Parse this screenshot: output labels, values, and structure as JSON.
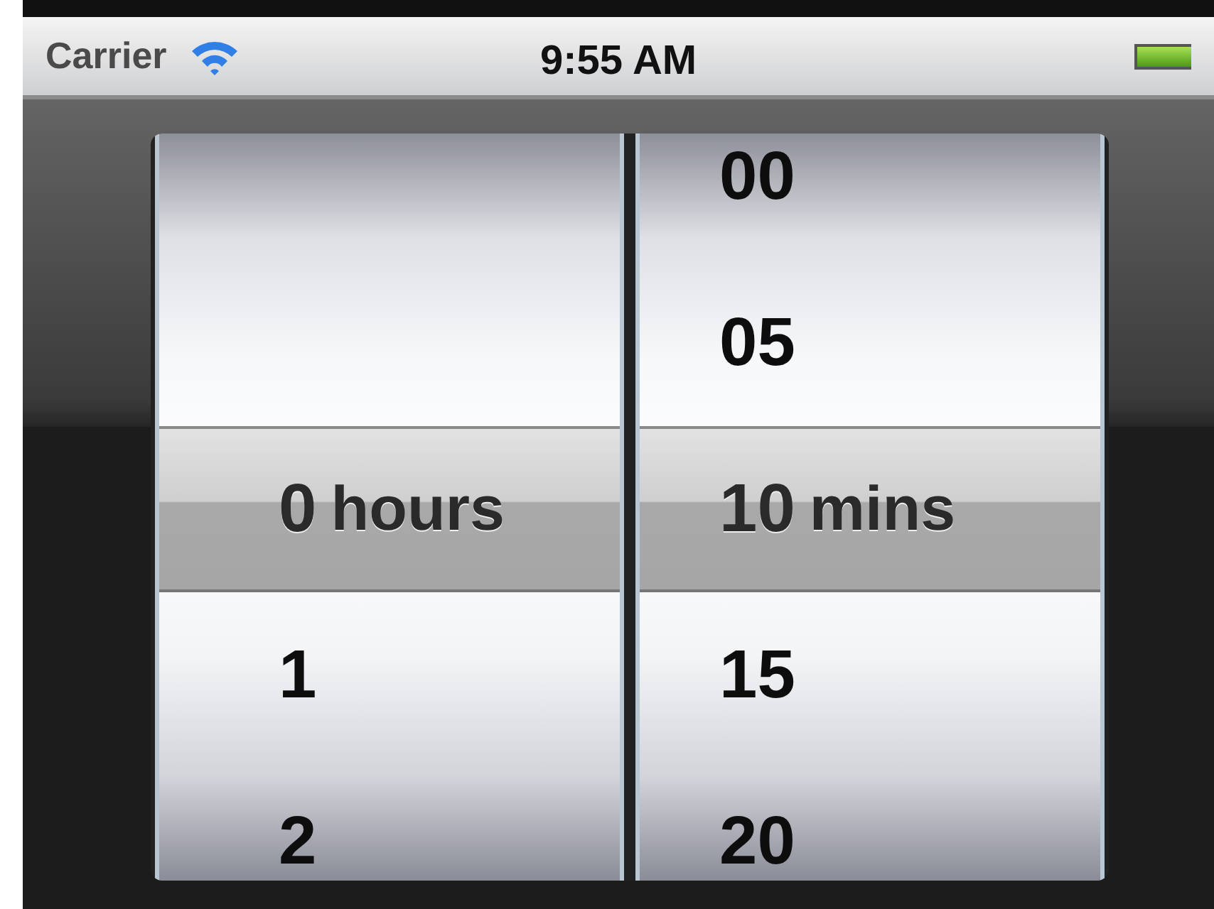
{
  "status_bar": {
    "carrier": "Carrier",
    "time": "9:55 AM"
  },
  "picker": {
    "columns": [
      {
        "items": [
          {
            "text": "0",
            "unit": "hours",
            "selected": true
          },
          {
            "text": "1",
            "selected": false
          },
          {
            "text": "2",
            "selected": false
          }
        ]
      },
      {
        "items": [
          {
            "text": "00",
            "selected": false
          },
          {
            "text": "05",
            "selected": false
          },
          {
            "text": "10",
            "unit": "mins",
            "selected": true
          },
          {
            "text": "15",
            "selected": false
          },
          {
            "text": "20",
            "selected": false
          }
        ]
      }
    ]
  }
}
